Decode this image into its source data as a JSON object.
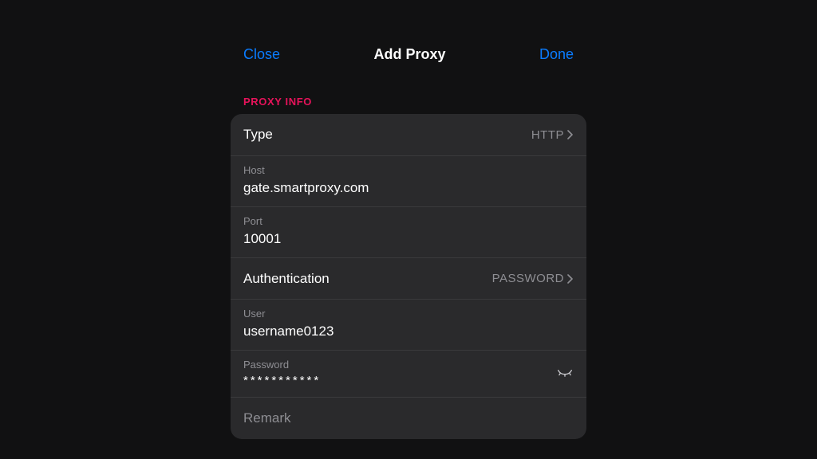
{
  "nav": {
    "close": "Close",
    "title": "Add Proxy",
    "done": "Done"
  },
  "section_label": "PROXY INFO",
  "rows": {
    "type": {
      "label": "Type",
      "value": "HTTP"
    },
    "host": {
      "label": "Host",
      "value": "gate.smartproxy.com"
    },
    "port": {
      "label": "Port",
      "value": "10001"
    },
    "auth": {
      "label": "Authentication",
      "value": "PASSWORD"
    },
    "user": {
      "label": "User",
      "value": "username0123"
    },
    "password": {
      "label": "Password",
      "masked": "***********"
    },
    "remark": {
      "placeholder": "Remark"
    }
  },
  "colors": {
    "accent_blue": "#0a7cff",
    "accent_pink": "#e6135a",
    "card_bg": "#2a2a2c",
    "page_bg": "#111112"
  }
}
